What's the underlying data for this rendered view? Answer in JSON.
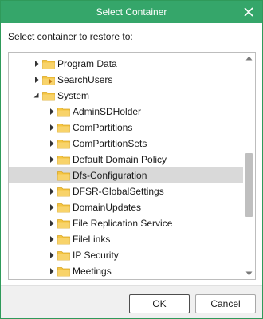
{
  "dialog": {
    "title": "Select Container",
    "close_icon": "close-icon",
    "prompt": "Select container to restore to:",
    "ok_label": "OK",
    "cancel_label": "Cancel",
    "accent_color": "#35a66a",
    "folder_color": "#f5c542"
  },
  "tree": {
    "items": [
      {
        "label": "Program Data",
        "expander": "collapsed",
        "icon": "folder-icon",
        "selected": false
      },
      {
        "label": "SearchUsers",
        "expander": "collapsed",
        "icon": "special-folder-icon",
        "selected": false
      },
      {
        "label": "System",
        "expander": "expanded",
        "icon": "folder-icon",
        "selected": false
      },
      {
        "label": "AdminSDHolder",
        "expander": "collapsed",
        "icon": "folder-icon",
        "selected": false
      },
      {
        "label": "ComPartitions",
        "expander": "collapsed",
        "icon": "folder-icon",
        "selected": false
      },
      {
        "label": "ComPartitionSets",
        "expander": "collapsed",
        "icon": "folder-icon",
        "selected": false
      },
      {
        "label": "Default Domain Policy",
        "expander": "collapsed",
        "icon": "folder-icon",
        "selected": false
      },
      {
        "label": "Dfs-Configuration",
        "expander": "none",
        "icon": "folder-icon",
        "selected": true
      },
      {
        "label": "DFSR-GlobalSettings",
        "expander": "collapsed",
        "icon": "folder-icon",
        "selected": false
      },
      {
        "label": "DomainUpdates",
        "expander": "collapsed",
        "icon": "folder-icon",
        "selected": false
      },
      {
        "label": "File Replication Service",
        "expander": "collapsed",
        "icon": "folder-icon",
        "selected": false
      },
      {
        "label": "FileLinks",
        "expander": "collapsed",
        "icon": "folder-icon",
        "selected": false
      },
      {
        "label": "IP Security",
        "expander": "collapsed",
        "icon": "folder-icon",
        "selected": false
      },
      {
        "label": "Meetings",
        "expander": "collapsed",
        "icon": "folder-icon",
        "selected": false
      }
    ]
  }
}
